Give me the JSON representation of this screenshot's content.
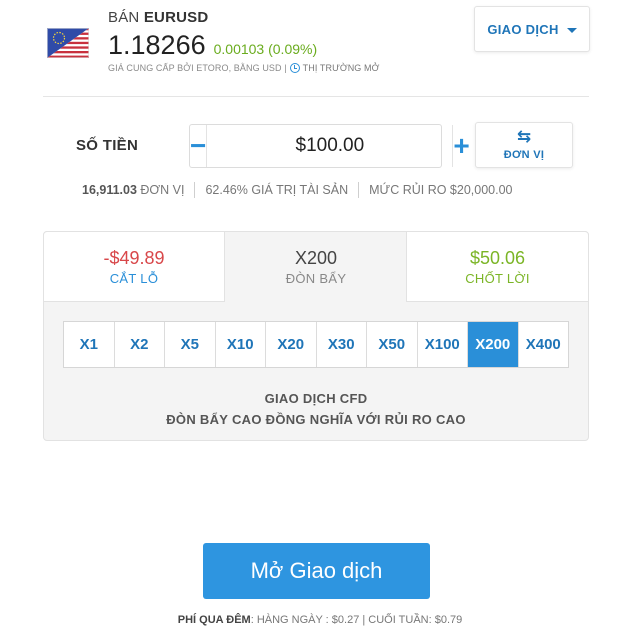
{
  "header": {
    "action": "BÁN",
    "instrument": "EURUSD",
    "price": "1.18266",
    "change": "0.00103 (0.09%)",
    "provider": "GIÁ CUNG CẤP BỞI ETORO, BẰNG USD |",
    "market_status": "THỊ TRƯỜNG MỞ",
    "trade_button": "GIAO DỊCH",
    "flag_icon": "eu-us-flag-icon"
  },
  "amount": {
    "label": "SỐ TIỀN",
    "value": "$100.00",
    "minus": "−",
    "plus": "+",
    "units_button": "ĐƠN VỊ",
    "units_icon": "⇆"
  },
  "stats": {
    "units_value": "16,911.03",
    "units_text": "ĐƠN VỊ",
    "equity": "62.46% GIÁ TRỊ TÀI SẢN",
    "risk": "MỨC RỦI RO $20,000.00"
  },
  "tabs": {
    "stop_loss": {
      "value": "-$49.89",
      "label": "CẮT LỖ"
    },
    "leverage": {
      "value": "X200",
      "label": "ĐÒN BẨY"
    },
    "take_profit": {
      "value": "$50.06",
      "label": "CHỐT LỜI"
    }
  },
  "leverage_options": [
    "X1",
    "X2",
    "X5",
    "X10",
    "X20",
    "X30",
    "X50",
    "X100",
    "X200",
    "X400"
  ],
  "leverage_selected": "X200",
  "notice": {
    "line1": "GIAO DỊCH CFD",
    "line2": "ĐÒN BẨY CAO ĐỒNG NGHĨA VỚI RỦI RO CAO"
  },
  "open_button": "Mở Giao dịch",
  "fees": {
    "label": "PHÍ QUA ĐÊM",
    "text": ": HÀNG NGÀY : $0.27 | CUỐI TUẦN: $0.79"
  },
  "colors": {
    "accent": "#2a8fd8",
    "positive": "#7bb526",
    "negative": "#d8474a"
  }
}
